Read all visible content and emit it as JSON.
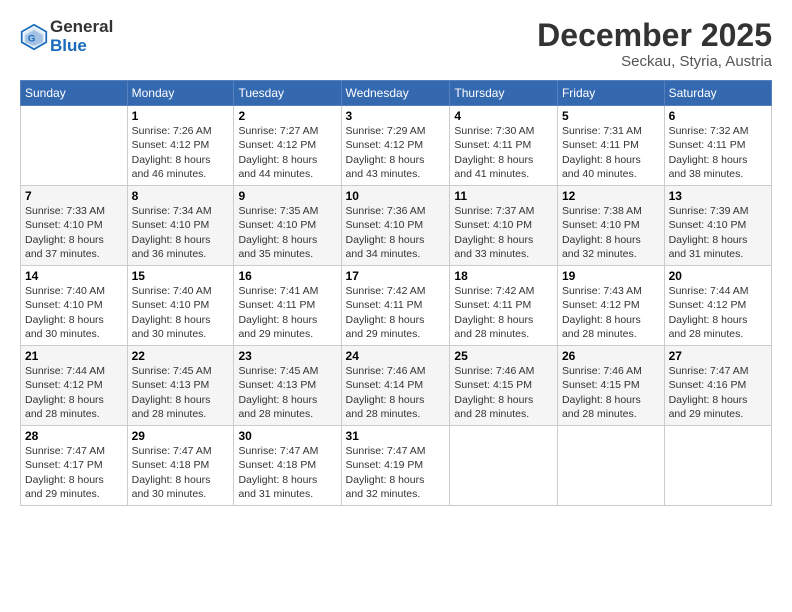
{
  "header": {
    "logo_line1": "General",
    "logo_line2": "Blue",
    "month_year": "December 2025",
    "location": "Seckau, Styria, Austria"
  },
  "days_of_week": [
    "Sunday",
    "Monday",
    "Tuesday",
    "Wednesday",
    "Thursday",
    "Friday",
    "Saturday"
  ],
  "weeks": [
    [
      {
        "day": "",
        "info": ""
      },
      {
        "day": "1",
        "info": "Sunrise: 7:26 AM\nSunset: 4:12 PM\nDaylight: 8 hours\nand 46 minutes."
      },
      {
        "day": "2",
        "info": "Sunrise: 7:27 AM\nSunset: 4:12 PM\nDaylight: 8 hours\nand 44 minutes."
      },
      {
        "day": "3",
        "info": "Sunrise: 7:29 AM\nSunset: 4:12 PM\nDaylight: 8 hours\nand 43 minutes."
      },
      {
        "day": "4",
        "info": "Sunrise: 7:30 AM\nSunset: 4:11 PM\nDaylight: 8 hours\nand 41 minutes."
      },
      {
        "day": "5",
        "info": "Sunrise: 7:31 AM\nSunset: 4:11 PM\nDaylight: 8 hours\nand 40 minutes."
      },
      {
        "day": "6",
        "info": "Sunrise: 7:32 AM\nSunset: 4:11 PM\nDaylight: 8 hours\nand 38 minutes."
      }
    ],
    [
      {
        "day": "7",
        "info": "Sunrise: 7:33 AM\nSunset: 4:10 PM\nDaylight: 8 hours\nand 37 minutes."
      },
      {
        "day": "8",
        "info": "Sunrise: 7:34 AM\nSunset: 4:10 PM\nDaylight: 8 hours\nand 36 minutes."
      },
      {
        "day": "9",
        "info": "Sunrise: 7:35 AM\nSunset: 4:10 PM\nDaylight: 8 hours\nand 35 minutes."
      },
      {
        "day": "10",
        "info": "Sunrise: 7:36 AM\nSunset: 4:10 PM\nDaylight: 8 hours\nand 34 minutes."
      },
      {
        "day": "11",
        "info": "Sunrise: 7:37 AM\nSunset: 4:10 PM\nDaylight: 8 hours\nand 33 minutes."
      },
      {
        "day": "12",
        "info": "Sunrise: 7:38 AM\nSunset: 4:10 PM\nDaylight: 8 hours\nand 32 minutes."
      },
      {
        "day": "13",
        "info": "Sunrise: 7:39 AM\nSunset: 4:10 PM\nDaylight: 8 hours\nand 31 minutes."
      }
    ],
    [
      {
        "day": "14",
        "info": "Sunrise: 7:40 AM\nSunset: 4:10 PM\nDaylight: 8 hours\nand 30 minutes."
      },
      {
        "day": "15",
        "info": "Sunrise: 7:40 AM\nSunset: 4:10 PM\nDaylight: 8 hours\nand 30 minutes."
      },
      {
        "day": "16",
        "info": "Sunrise: 7:41 AM\nSunset: 4:11 PM\nDaylight: 8 hours\nand 29 minutes."
      },
      {
        "day": "17",
        "info": "Sunrise: 7:42 AM\nSunset: 4:11 PM\nDaylight: 8 hours\nand 29 minutes."
      },
      {
        "day": "18",
        "info": "Sunrise: 7:42 AM\nSunset: 4:11 PM\nDaylight: 8 hours\nand 28 minutes."
      },
      {
        "day": "19",
        "info": "Sunrise: 7:43 AM\nSunset: 4:12 PM\nDaylight: 8 hours\nand 28 minutes."
      },
      {
        "day": "20",
        "info": "Sunrise: 7:44 AM\nSunset: 4:12 PM\nDaylight: 8 hours\nand 28 minutes."
      }
    ],
    [
      {
        "day": "21",
        "info": "Sunrise: 7:44 AM\nSunset: 4:12 PM\nDaylight: 8 hours\nand 28 minutes."
      },
      {
        "day": "22",
        "info": "Sunrise: 7:45 AM\nSunset: 4:13 PM\nDaylight: 8 hours\nand 28 minutes."
      },
      {
        "day": "23",
        "info": "Sunrise: 7:45 AM\nSunset: 4:13 PM\nDaylight: 8 hours\nand 28 minutes."
      },
      {
        "day": "24",
        "info": "Sunrise: 7:46 AM\nSunset: 4:14 PM\nDaylight: 8 hours\nand 28 minutes."
      },
      {
        "day": "25",
        "info": "Sunrise: 7:46 AM\nSunset: 4:15 PM\nDaylight: 8 hours\nand 28 minutes."
      },
      {
        "day": "26",
        "info": "Sunrise: 7:46 AM\nSunset: 4:15 PM\nDaylight: 8 hours\nand 28 minutes."
      },
      {
        "day": "27",
        "info": "Sunrise: 7:47 AM\nSunset: 4:16 PM\nDaylight: 8 hours\nand 29 minutes."
      }
    ],
    [
      {
        "day": "28",
        "info": "Sunrise: 7:47 AM\nSunset: 4:17 PM\nDaylight: 8 hours\nand 29 minutes."
      },
      {
        "day": "29",
        "info": "Sunrise: 7:47 AM\nSunset: 4:18 PM\nDaylight: 8 hours\nand 30 minutes."
      },
      {
        "day": "30",
        "info": "Sunrise: 7:47 AM\nSunset: 4:18 PM\nDaylight: 8 hours\nand 31 minutes."
      },
      {
        "day": "31",
        "info": "Sunrise: 7:47 AM\nSunset: 4:19 PM\nDaylight: 8 hours\nand 32 minutes."
      },
      {
        "day": "",
        "info": ""
      },
      {
        "day": "",
        "info": ""
      },
      {
        "day": "",
        "info": ""
      }
    ]
  ]
}
